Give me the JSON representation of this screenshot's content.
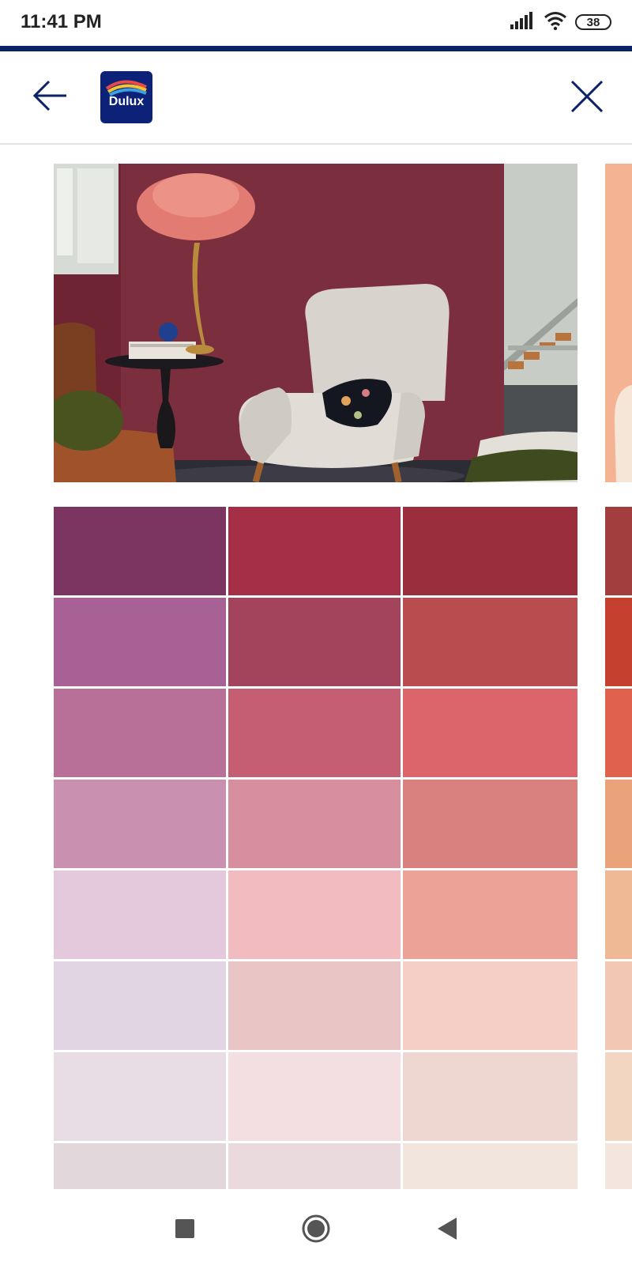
{
  "status_bar": {
    "time": "11:41 PM",
    "battery_level": "38",
    "icons": [
      "signal-icon",
      "wifi-icon",
      "battery-icon"
    ]
  },
  "header": {
    "logo_text": "Dulux",
    "icons": [
      "back-arrow-icon",
      "close-icon"
    ]
  },
  "colors": {
    "accent": "#0a2268"
  },
  "palette": {
    "swatches": [
      "#7b3560",
      "#a52f47",
      "#9b2e3c",
      "#a86195",
      "#a3445c",
      "#b94c4e",
      "#b87098",
      "#c55d73",
      "#dc646b",
      "#c990b0",
      "#d78f9d",
      "#d8817e",
      "#e4c8dc",
      "#f1bbc0",
      "#eda298",
      "#e2d5e3",
      "#eac5c6",
      "#f5cec6",
      "#e9dde5",
      "#f3dfe2",
      "#eed7d0",
      "#e2d8dc",
      "#ead9dd",
      "#f1e5dd"
    ],
    "next_column": [
      "#a23e3e",
      "#c6402f",
      "#e0614c",
      "#eaa27a",
      "#f0b996",
      "#f2c8b4",
      "#f3d6c1",
      "#f4e6de"
    ]
  },
  "navigation": {
    "icons": [
      "recent-apps-icon",
      "home-icon",
      "back-icon"
    ]
  }
}
